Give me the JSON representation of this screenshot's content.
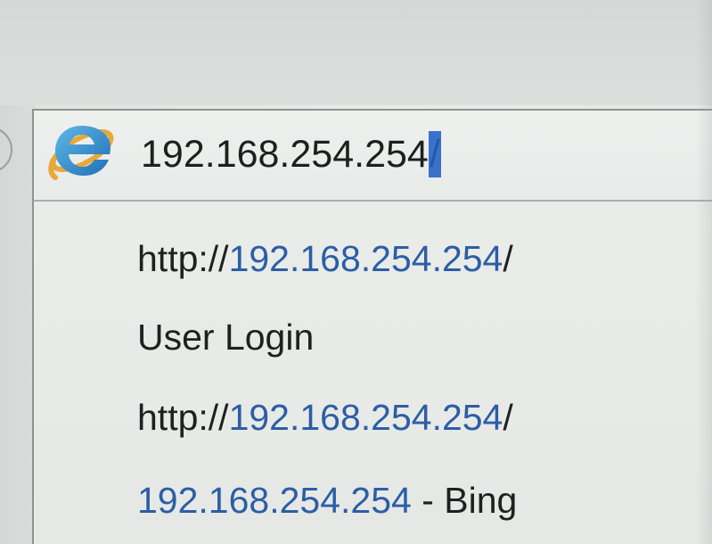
{
  "address_bar": {
    "url_typed": "192.168.254.254",
    "url_selected_completion": "/"
  },
  "icons": {
    "browser": "internet-explorer-icon"
  },
  "suggestions": [
    {
      "prefix": "http://",
      "host": "192.168.254.254",
      "suffix": "/"
    },
    {
      "title": "User Login"
    },
    {
      "prefix": "http://",
      "host": "192.168.254.254",
      "suffix": "/"
    },
    {
      "query": "192.168.254.254",
      "provider_sep": " - ",
      "provider": "Bing"
    }
  ],
  "colors": {
    "link": "#2b5ea6",
    "selection": "#3a72c9",
    "text": "#1f2020"
  }
}
